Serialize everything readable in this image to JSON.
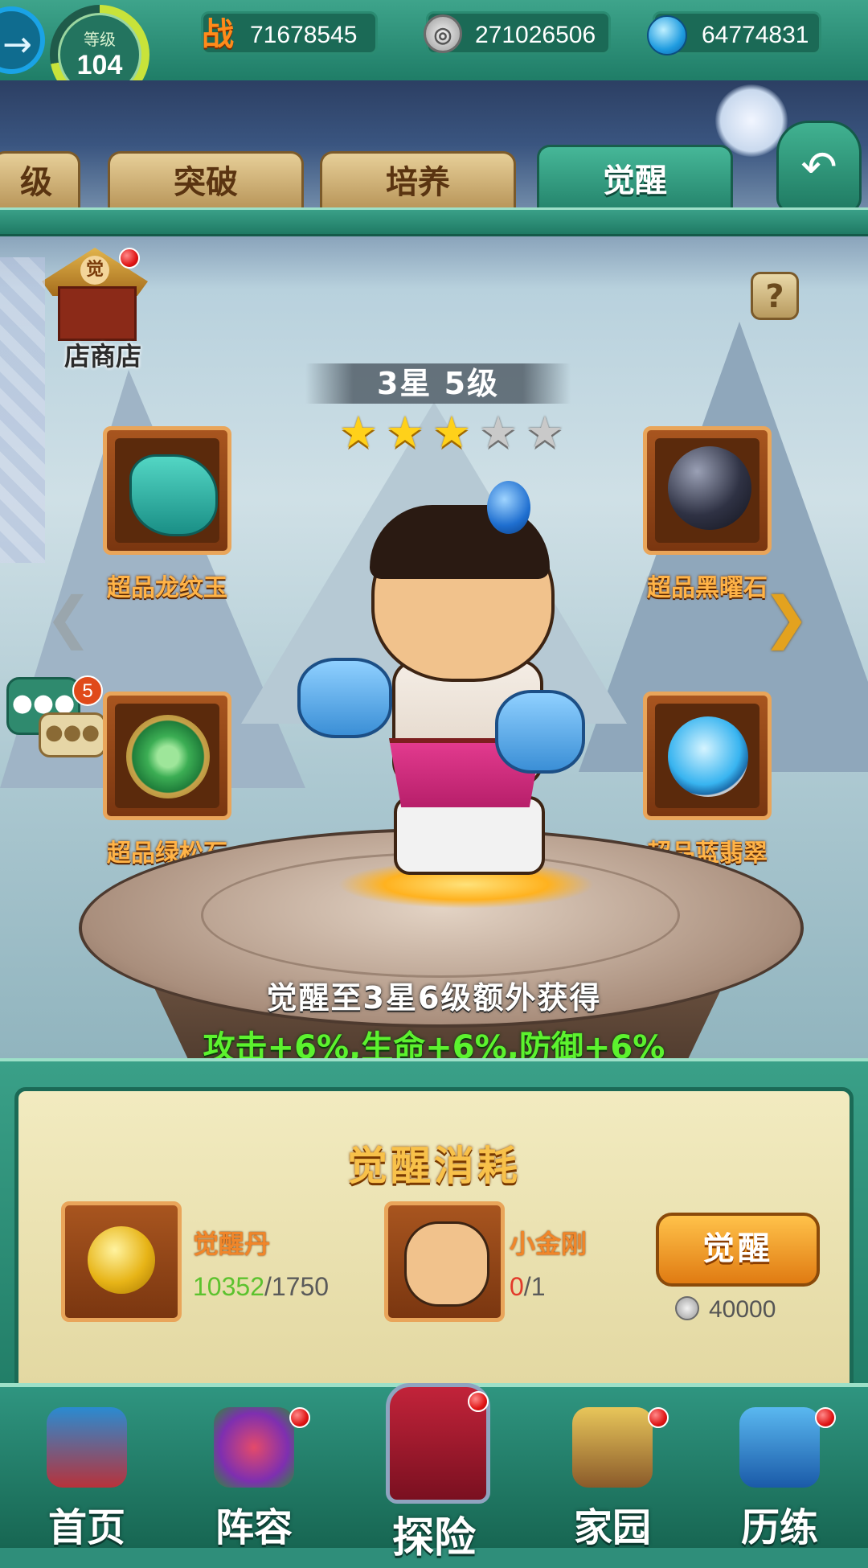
{
  "topbar": {
    "level_label": "等级",
    "level_value": "104",
    "power_icon": "战",
    "power_value": "71678545",
    "coin_icon": "coin-icon",
    "coin_value": "271026506",
    "gem_icon": "water-gem-icon",
    "gem_value": "64774831"
  },
  "tabs": [
    {
      "label": "级",
      "active": false
    },
    {
      "label": "突破",
      "active": false
    },
    {
      "label": "培养",
      "active": false
    },
    {
      "label": "觉醒",
      "active": true
    }
  ],
  "shop": {
    "sign": "觉",
    "label": "店商店"
  },
  "chat": {
    "badge": "5"
  },
  "hero": {
    "level_text": "3星 5级",
    "stars_filled": 3,
    "stars_total": 5
  },
  "materials": [
    {
      "name": "超品龙纹玉"
    },
    {
      "name": "超品黑曜石"
    },
    {
      "name": "超品绿松石"
    },
    {
      "name": "超品蓝翡翠"
    }
  ],
  "awaken": {
    "info": "觉醒至3星6级额外获得",
    "bonus": "攻击+6%,生命+6%,防御+6%"
  },
  "cost_panel": {
    "title": "觉醒消耗",
    "item1_name": "觉醒丹",
    "item1_have": "10352",
    "item1_need": "/1750",
    "item2_name": "小金刚",
    "item2_have": "0",
    "item2_need": "/1",
    "button_label": "觉醒",
    "button_cost": "40000"
  },
  "nav": [
    {
      "label": "首页"
    },
    {
      "label": "阵容"
    },
    {
      "label": "探险"
    },
    {
      "label": "家园"
    },
    {
      "label": "历练"
    }
  ],
  "colors": {
    "accent_green": "#2f9580",
    "gold": "#f8c14a",
    "bonus_green": "#5cf22e",
    "alert_red": "#e01616"
  }
}
